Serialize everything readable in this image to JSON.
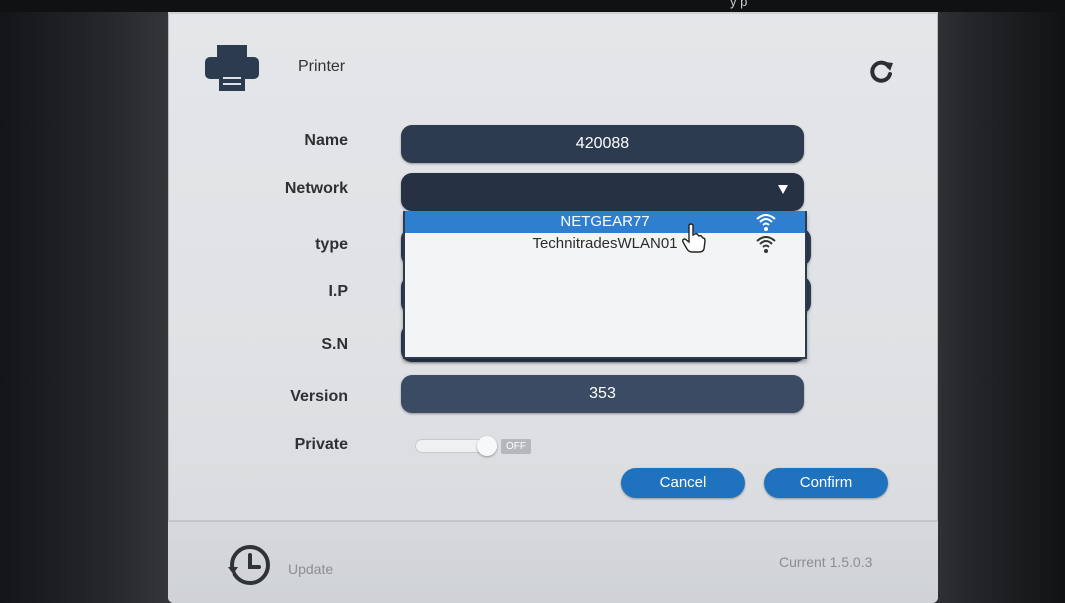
{
  "bezel": {
    "top_text": "y        p"
  },
  "section": {
    "title": "Printer"
  },
  "form": {
    "name_label": "Name",
    "name_value": "420088",
    "network_label": "Network",
    "network_value": "",
    "type_label": "type",
    "ip_label": "I.P",
    "sn_label": "S.N",
    "version_label": "Version",
    "version_value": "353",
    "private_label": "Private",
    "private_state": "OFF"
  },
  "dropdown": {
    "items": [
      {
        "label": "NETGEAR77",
        "selected": true
      },
      {
        "label": "TechnitradesWLAN01",
        "selected": false
      }
    ]
  },
  "buttons": {
    "cancel": "Cancel",
    "confirm": "Confirm"
  },
  "footer": {
    "update_label": "Update",
    "current_version": "Current 1.5.0.3"
  },
  "colors": {
    "field_bg": "#2c3b50",
    "button_bg": "#1f72bd",
    "selected_item": "#2f7fd1",
    "panel_bg": "#e2e4e7"
  },
  "icons": [
    "printer-icon",
    "refresh-icon",
    "chevron-down-icon",
    "wifi-icon",
    "hand-cursor-icon",
    "history-icon"
  ]
}
